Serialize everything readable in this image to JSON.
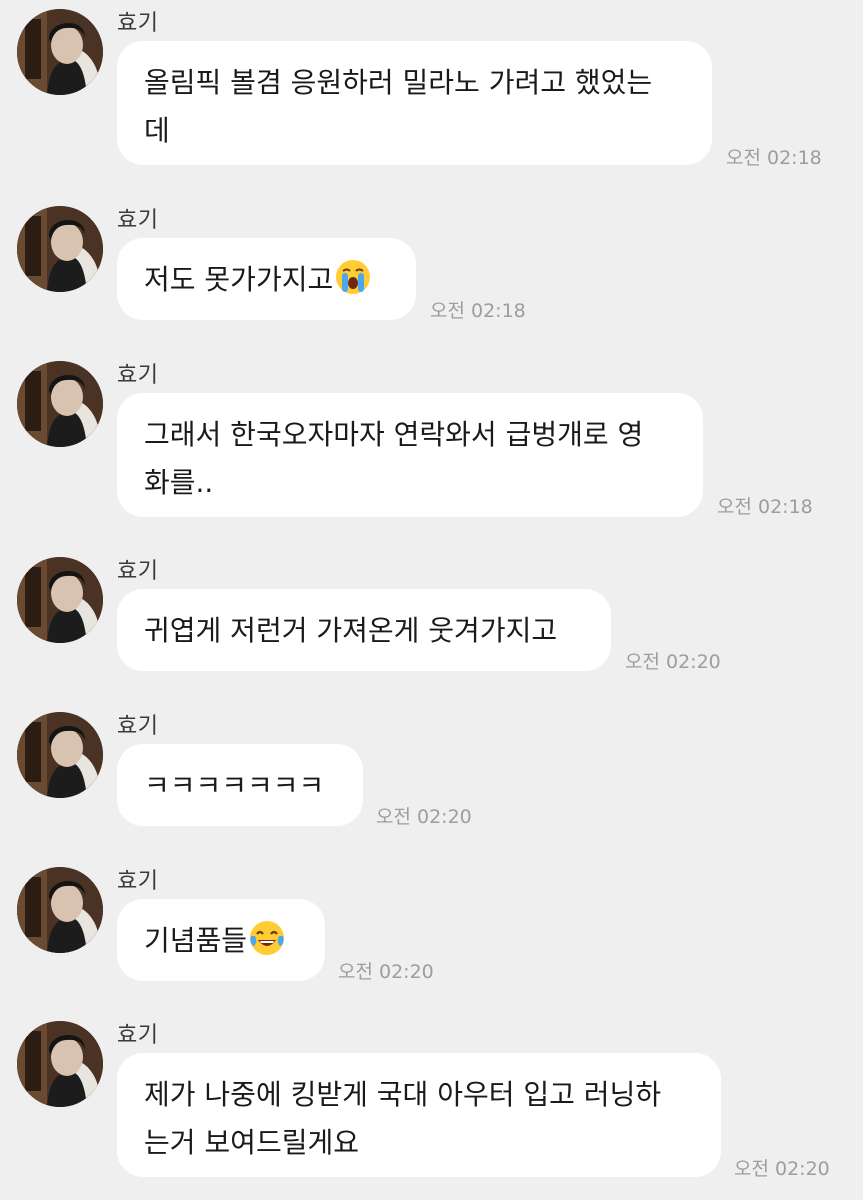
{
  "chat": {
    "messages": [
      {
        "sender": "효기",
        "text_lines": [
          "올림픽 볼겸 응원하러 밀라노 가려고 했었는",
          "데"
        ],
        "time": "오전 02:18"
      },
      {
        "sender": "효기",
        "text_lines": [
          "저도 못가가지고"
        ],
        "emoji": "loudly-crying-face-icon",
        "time": "오전 02:18"
      },
      {
        "sender": "효기",
        "text_lines": [
          "그래서 한국오자마자 연락와서 급벙개로 영",
          "화를.."
        ],
        "time": "오전 02:18"
      },
      {
        "sender": "효기",
        "text_lines": [
          "귀엽게 저런거 가져온게 웃겨가지고"
        ],
        "time": "오전 02:20"
      },
      {
        "sender": "효기",
        "text_lines": [
          "ㅋㅋㅋㅋㅋㅋㅋ"
        ],
        "time": "오전 02:20"
      },
      {
        "sender": "효기",
        "text_lines": [
          "기념품들"
        ],
        "emoji": "face-with-tears-of-joy-icon",
        "time": "오전 02:20"
      },
      {
        "sender": "효기",
        "text_lines": [
          "제가 나중에 킹받게 국대 아우터 입고 러닝하",
          "는거 보여드릴게요"
        ],
        "time": "오전 02:20"
      }
    ]
  },
  "colors": {
    "background": "#efefef",
    "bubble": "#ffffff",
    "text": "#1a1a1a",
    "timestamp": "#9d9d9d"
  }
}
